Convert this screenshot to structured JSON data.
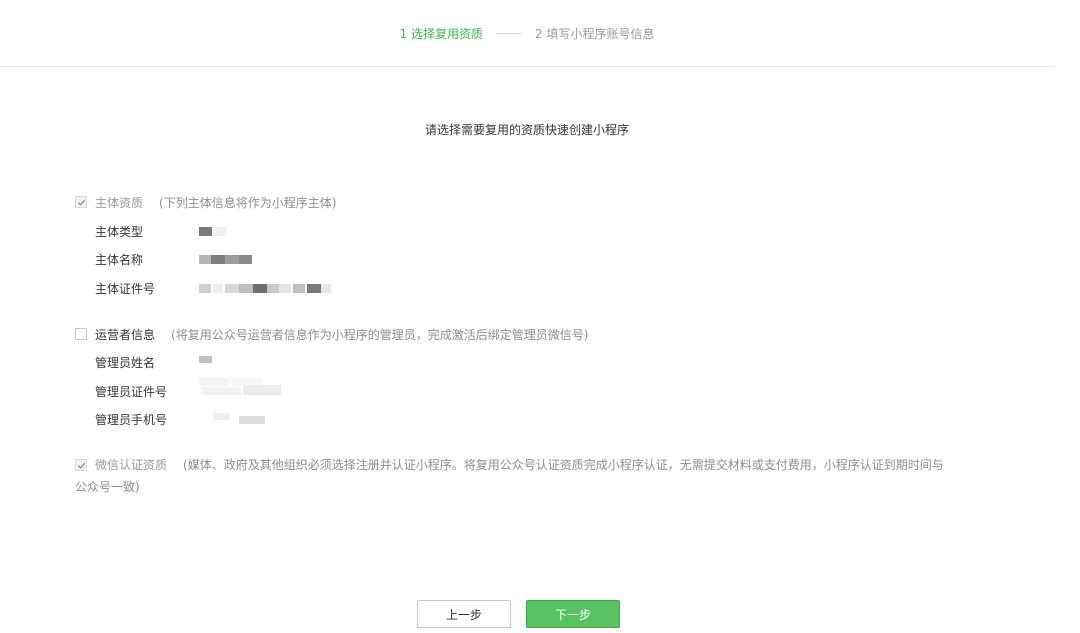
{
  "steps": {
    "step1": "1 选择复用资质",
    "step2": "2 填写小程序账号信息"
  },
  "heading": "请选择需要复用的资质快速创建小程序",
  "subject": {
    "title": "主体资质",
    "desc": "(下列主体信息将作为小程序主体)",
    "checked": true,
    "disabled": true,
    "fields": [
      {
        "label": "主体类型"
      },
      {
        "label": "主体名称"
      },
      {
        "label": "主体证件号"
      }
    ]
  },
  "operator": {
    "title": "运营者信息",
    "desc": "(将复用公众号运营者信息作为小程序的管理员，完成激活后绑定管理员微信号)",
    "checked": false,
    "fields": [
      {
        "label": "管理员姓名"
      },
      {
        "label": "管理员证件号"
      },
      {
        "label": "管理员手机号"
      }
    ]
  },
  "wechat_cert": {
    "title": "微信认证资质",
    "desc_line1": "(媒体、政府及其他组织必须选择注册并认证小程序。将复用公众号认证资质完成小程序认证，无需提交材料或支付费用，小程序认证到期时间与",
    "desc_line2": "公众号一致)",
    "checked": true,
    "disabled": true
  },
  "buttons": {
    "prev": "上一步",
    "next": "下一步"
  },
  "colors": {
    "accent": "#44b549",
    "primary_button": "#58c162"
  }
}
